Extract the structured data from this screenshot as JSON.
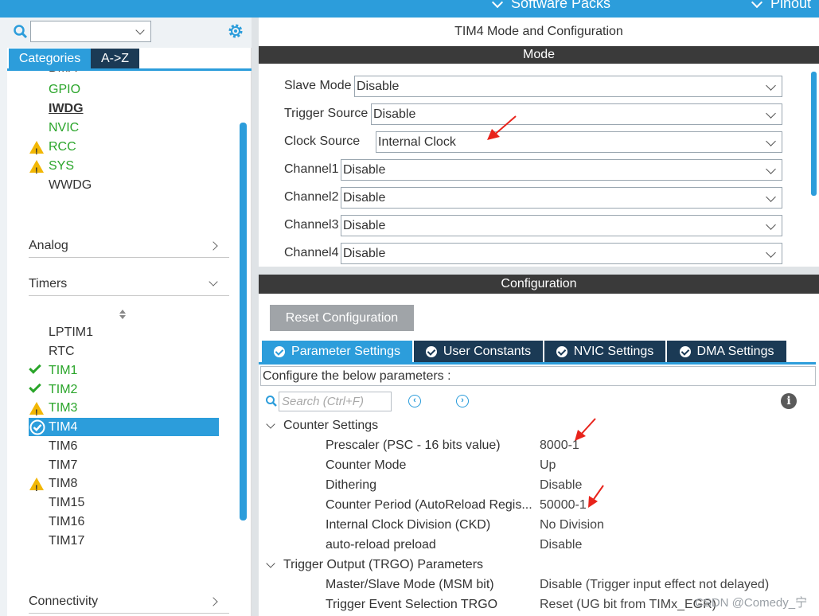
{
  "top_menu": {
    "software_packs": "Software Packs",
    "pinout": "Pinout"
  },
  "left": {
    "tabs": {
      "categories": "Categories",
      "a_to_z": "A->Z"
    },
    "system_items": [
      {
        "label": "DMA",
        "style": "plain",
        "status": "none"
      },
      {
        "label": "GPIO",
        "style": "green",
        "status": "none"
      },
      {
        "label": "IWDG",
        "style": "bold",
        "status": "none"
      },
      {
        "label": "NVIC",
        "style": "green",
        "status": "none"
      },
      {
        "label": "RCC",
        "style": "green",
        "status": "warning"
      },
      {
        "label": "SYS",
        "style": "green",
        "status": "warning"
      },
      {
        "label": "WWDG",
        "style": "plain",
        "status": "none"
      }
    ],
    "analog": "Analog",
    "timers": "Timers",
    "timer_items": [
      {
        "label": "LPTIM1",
        "style": "plain",
        "status": "none"
      },
      {
        "label": "RTC",
        "style": "plain",
        "status": "none"
      },
      {
        "label": "TIM1",
        "style": "green",
        "status": "ok"
      },
      {
        "label": "TIM2",
        "style": "green",
        "status": "ok"
      },
      {
        "label": "TIM3",
        "style": "green",
        "status": "warning"
      },
      {
        "label": "TIM4",
        "style": "selected",
        "status": "ok"
      },
      {
        "label": "TIM6",
        "style": "plain",
        "status": "none"
      },
      {
        "label": "TIM7",
        "style": "plain",
        "status": "none"
      },
      {
        "label": "TIM8",
        "style": "plain",
        "status": "warning"
      },
      {
        "label": "TIM15",
        "style": "plain",
        "status": "none"
      },
      {
        "label": "TIM16",
        "style": "plain",
        "status": "none"
      },
      {
        "label": "TIM17",
        "style": "plain",
        "status": "none"
      }
    ],
    "connectivity": "Connectivity"
  },
  "right": {
    "title": "TIM4 Mode and Configuration",
    "mode_header": "Mode",
    "mode_rows": [
      {
        "label": "Slave Mode",
        "value": "Disable"
      },
      {
        "label": "Trigger Source",
        "value": "Disable"
      },
      {
        "label": "Clock Source",
        "value": "Internal Clock"
      },
      {
        "label": "Channel1",
        "value": "Disable"
      },
      {
        "label": "Channel2",
        "value": "Disable"
      },
      {
        "label": "Channel3",
        "value": "Disable"
      },
      {
        "label": "Channel4",
        "value": "Disable"
      }
    ],
    "config_header": "Configuration",
    "reset_button": "Reset Configuration",
    "config_tabs": [
      "Parameter Settings",
      "User Constants",
      "NVIC Settings",
      "DMA Settings"
    ],
    "configure_text": "Configure the below parameters :",
    "search_placeholder": "Search (Ctrl+F)",
    "counter_settings": {
      "title": "Counter Settings",
      "params": [
        {
          "name": "Prescaler (PSC - 16 bits value)",
          "value": "8000-1"
        },
        {
          "name": "Counter Mode",
          "value": "Up"
        },
        {
          "name": "Dithering",
          "value": "Disable"
        },
        {
          "name": "Counter Period (AutoReload Regis...",
          "value": "50000-1"
        },
        {
          "name": "Internal Clock Division (CKD)",
          "value": "No Division"
        },
        {
          "name": "auto-reload preload",
          "value": "Disable"
        }
      ]
    },
    "trgo": {
      "title": "Trigger Output (TRGO) Parameters",
      "params": [
        {
          "name": "Master/Slave Mode (MSM bit)",
          "value": "Disable (Trigger input effect not delayed)"
        },
        {
          "name": "Trigger Event Selection TRGO",
          "value": "Reset (UG bit from TIMx_EGR)"
        }
      ]
    }
  },
  "watermark": "CSDN @Comedy_宁",
  "colors": {
    "accent": "#2c9ddb",
    "dark_tab": "#1b3a55",
    "ok_green": "#2aa52a",
    "warning": "#f2b705",
    "annotation_arrow": "#e8231b"
  }
}
